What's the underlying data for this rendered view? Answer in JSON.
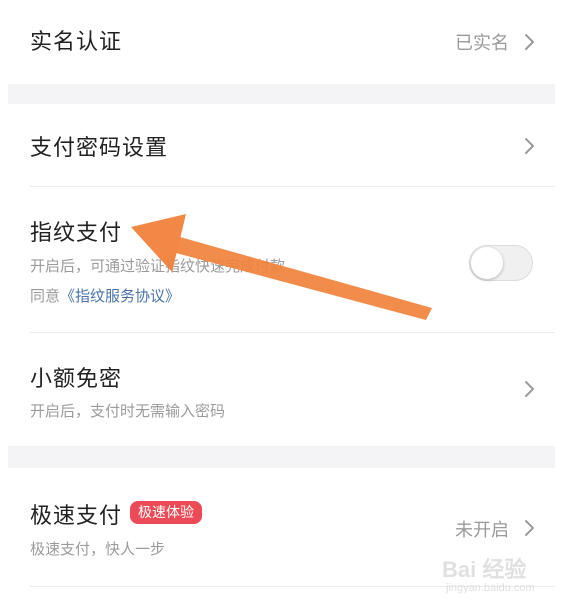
{
  "real_name": {
    "title": "实名认证",
    "status": "已实名"
  },
  "payment_password": {
    "title": "支付密码设置"
  },
  "fingerprint_pay": {
    "title": "指纹支付",
    "description": "开启后，可通过验证指纹快速完成付款",
    "agreement_prefix": "同意",
    "agreement_link": "《指纹服务协议》",
    "enabled": false
  },
  "small_no_password": {
    "title": "小额免密",
    "description": "开启后，支付时无需输入密码"
  },
  "express_pay": {
    "title": "极速支付",
    "badge": "极速体验",
    "description": "极速支付，快人一步",
    "status": "未开启"
  },
  "colors": {
    "annotation_arrow": "#f0823c",
    "badge": "#ec4a56",
    "link": "#4a72a8",
    "section_gap": "#f4f4f6"
  },
  "watermark": {
    "text": "Bai 经验",
    "sub": "jingyan.baidu.com"
  }
}
